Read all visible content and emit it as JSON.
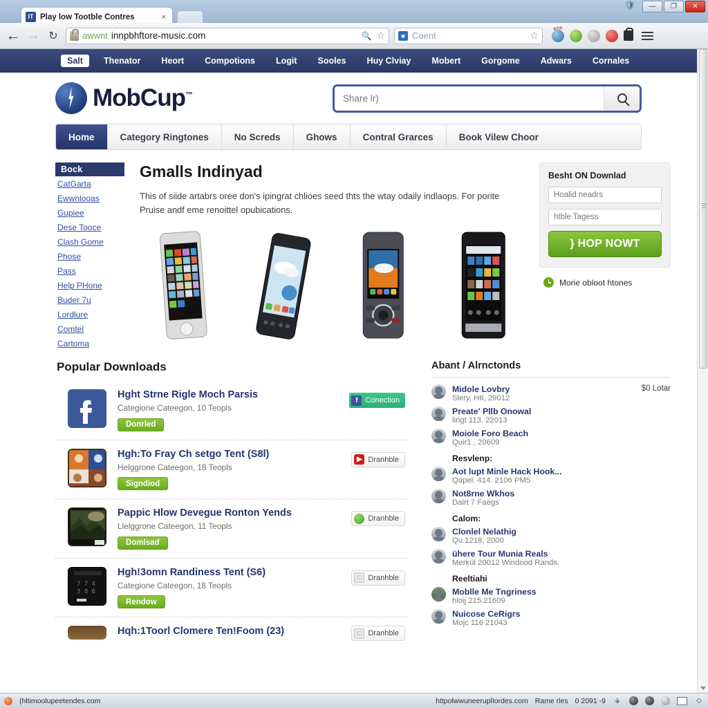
{
  "browser": {
    "tab": {
      "title": "Play low Tootble Contres",
      "favicon": "site-favicon",
      "close_label": "×"
    },
    "new_tab_label": "",
    "window_buttons": {
      "minimize": "—",
      "maximize": "❐",
      "close": "✕"
    },
    "toolbar": {
      "back": "←",
      "forward": "→",
      "reload": "↻",
      "url_scheme": "awwnt",
      "url_text": "innpbhftore-music.com",
      "search_placeholder": "Coent",
      "menu": "hamburger-menu"
    }
  },
  "topmenu": {
    "selected": "Salt",
    "items": [
      "Thenator",
      "Heort",
      "Compotions",
      "Logit",
      "Sooles",
      "Huy Clviay",
      "Mobert",
      "Gorgome",
      "Adwars",
      "Cornales"
    ]
  },
  "brand": {
    "name": "MobCup",
    "tm": "™"
  },
  "search": {
    "placeholder": "Share lr)",
    "value": "",
    "button_icon": "search-icon"
  },
  "tabs": [
    {
      "label": "Home",
      "active": true
    },
    {
      "label": "Category Ringtones",
      "active": false
    },
    {
      "label": "No Screds",
      "active": false
    },
    {
      "label": "Ghows",
      "active": false
    },
    {
      "label": "Contral Grarces",
      "active": false
    },
    {
      "label": "Book Vilew Choor",
      "active": false
    }
  ],
  "sidebar": {
    "header": "Bock",
    "links": [
      "CatGarta",
      "Ewwnlooas",
      "Gupiee",
      "Dese Tooce",
      "Clash Gome",
      "Phose",
      "Pass",
      "Help PHone",
      "Buder 7u",
      "Lordlure",
      "Comtel",
      "Cartoma"
    ]
  },
  "hero": {
    "title": "Gmalls Indinyad",
    "paragraph": "This of siide artabrs oree don's ipingrat chlioes seed thts the wtay odaily indlaops. For porite Pruise andf eme renoittel opubications.",
    "phones": [
      "phone-white-ios",
      "phone-black-android",
      "phone-grey-candybar",
      "phone-black-smartphone"
    ]
  },
  "promo": {
    "header": "Besht ON Downlad",
    "field1_placeholder": "Hoalid neadrs",
    "field2_placeholder": "htble Tagess",
    "button_label": "} HOP NOWT",
    "footer_label": "Morie obloot htones",
    "footer_icon": "clock-icon",
    "button_color": "#6aac1f"
  },
  "popular": {
    "header": "Popular Downloads",
    "items": [
      {
        "thumb": "facebook-icon",
        "title": "Hght Strne Rigle Moch Parsis",
        "subtitle": "Categione Cateegon, 10 Teopls",
        "download_label": "Donrled",
        "badge_label": "Conection",
        "badge_icon": "facebook-mini-icon",
        "badge_style": "fb"
      },
      {
        "thumb": "app-collage-icon",
        "title": "Hgh:To Fray Ch setgo Tent (S8l)",
        "subtitle": "Helggrone Cateegon, 18 Teopls",
        "download_label": "Signdiod",
        "badge_label": "Dranhble",
        "badge_icon": "youtube-mini-icon",
        "badge_style": "plain"
      },
      {
        "thumb": "landscape-painting-icon",
        "title": "Pappic Hlow Devegue Ronton Yends",
        "subtitle": "Llelggrone Cateegon, 11 Teopls",
        "download_label": "Domlsad",
        "badge_label": "Dranhble",
        "badge_icon": "green-circle-mini-icon",
        "badge_style": "plain"
      },
      {
        "thumb": "black-phone-icon",
        "title": "Hgh!3omn Randiness Tent (S6)",
        "subtitle": "Categione Cateegon, 18 Teopls",
        "download_label": "Rendow",
        "badge_label": "Dranhble",
        "badge_icon": "generic-mini-icon",
        "badge_style": "plain"
      },
      {
        "thumb": "partial-thumb-icon",
        "title": "Hqh:1Toorl Clomere Ten!Foom (23)",
        "subtitle": "",
        "download_label": "",
        "badge_label": "Dranhble",
        "badge_icon": "generic-mini-icon",
        "badge_style": "plain"
      }
    ]
  },
  "comments": {
    "header": "Abant / Alrnctonds",
    "first_price": "$0 Lotar",
    "entries": [
      {
        "type": "item",
        "name": "Midole Lovbry",
        "date": "Slery, H6, 29012"
      },
      {
        "type": "item",
        "name": "Preate' Pllb Onowal",
        "date": "lińgt 113. 22013"
      },
      {
        "type": "item",
        "name": "Moiole Foro Beach",
        "date": "Quir1 , 20609"
      },
      {
        "type": "section",
        "label": "Resvlenp:"
      },
      {
        "type": "item",
        "name": "Aot lupt Minle Hack Hook...",
        "date": "Qapel. 414. 2106 PM5"
      },
      {
        "type": "item",
        "name": "Not8rne Wkhos",
        "date": "Dalrt 7 Faegs"
      },
      {
        "type": "section",
        "label": "Calom:"
      },
      {
        "type": "item",
        "name": "Clonlel Nelathig",
        "date": "Qu.1218, 2000"
      },
      {
        "type": "item",
        "name": "ühere Tour Munia Reals",
        "date": "Merķül 20012 Windood Rands."
      },
      {
        "type": "section",
        "label": "Reeltiahi"
      },
      {
        "type": "item",
        "name": "Moblle Me Tngriness",
        "date": "hloij 215.21609"
      },
      {
        "type": "item",
        "name": "Nuicose CeRigrs",
        "date": "Mojc 116 21043"
      }
    ]
  },
  "statusbar": {
    "left_text": "(hltimoolupeetendes.com",
    "mid_text": "httpolwwuneeruplIordes.com",
    "right_label": "Rame rles",
    "right_value": "0 2091 -9"
  }
}
